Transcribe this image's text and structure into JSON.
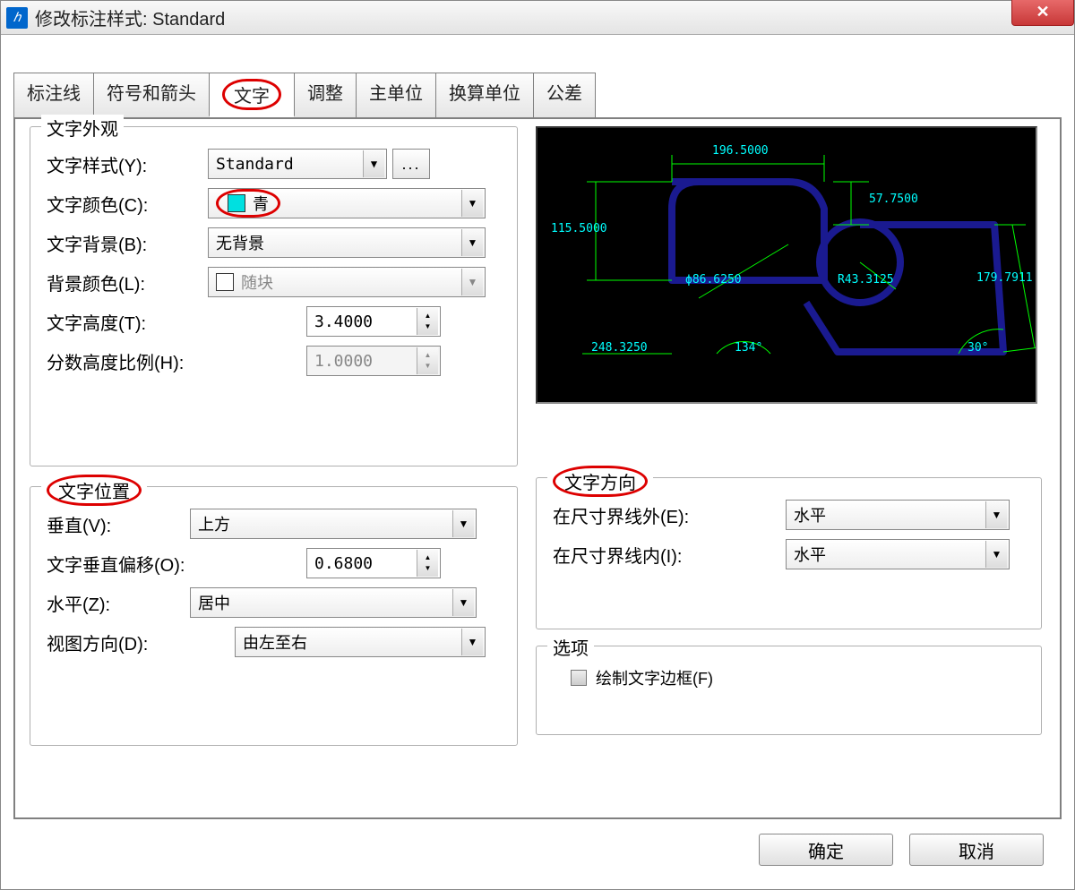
{
  "window": {
    "title": "修改标注样式: Standard"
  },
  "tabs": {
    "t0": "标注线",
    "t1": "符号和箭头",
    "t2": "文字",
    "t3": "调整",
    "t4": "主单位",
    "t5": "换算单位",
    "t6": "公差"
  },
  "appearance": {
    "title": "文字外观",
    "style_label": "文字样式(Y):",
    "style_value": "Standard",
    "more_btn": "...",
    "color_label": "文字颜色(C):",
    "color_value": "青",
    "color_hex": "#00e0e0",
    "bg_label": "文字背景(B):",
    "bg_value": "无背景",
    "bgcolor_label": "背景颜色(L):",
    "bgcolor_value": "随块",
    "height_label": "文字高度(T):",
    "height_value": "3.4000",
    "fraction_label": "分数高度比例(H):",
    "fraction_value": "1.0000"
  },
  "position": {
    "title": "文字位置",
    "vertical_label": "垂直(V):",
    "vertical_value": "上方",
    "voffset_label": "文字垂直偏移(O):",
    "voffset_value": "0.6800",
    "horizontal_label": "水平(Z):",
    "horizontal_value": "居中",
    "viewdir_label": "视图方向(D):",
    "viewdir_value": "由左至右"
  },
  "direction": {
    "title": "文字方向",
    "outside_label": "在尺寸界线外(E):",
    "outside_value": "水平",
    "inside_label": "在尺寸界线内(I):",
    "inside_value": "水平"
  },
  "options": {
    "title": "选项",
    "drawframe_label": "绘制文字边框(F)"
  },
  "preview": {
    "d1": "196.5000",
    "d2": "57.7500",
    "d3": "115.5000",
    "d4": "179.7911",
    "d5": "ϕ86.6250",
    "d6": "R43.3125",
    "d7": "248.3250",
    "d8": "134°",
    "d9": "30°"
  },
  "buttons": {
    "ok": "确定",
    "cancel": "取消"
  }
}
